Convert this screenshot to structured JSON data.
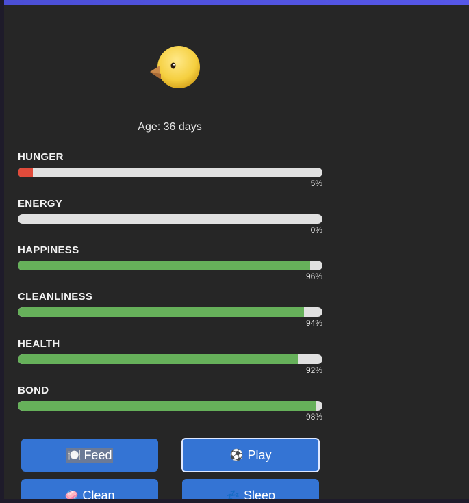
{
  "pet": {
    "age_text": "Age: 36 days",
    "icon": "baby-chick-icon"
  },
  "stats": [
    {
      "label": "HUNGER",
      "percent_text": "5%",
      "value": 5,
      "color": "#e14b3b"
    },
    {
      "label": "ENERGY",
      "percent_text": "0%",
      "value": 0,
      "color": "#66b05a"
    },
    {
      "label": "HAPPINESS",
      "percent_text": "96%",
      "value": 96,
      "color": "#66b05a"
    },
    {
      "label": "CLEANLINESS",
      "percent_text": "94%",
      "value": 94,
      "color": "#66b05a"
    },
    {
      "label": "HEALTH",
      "percent_text": "92%",
      "value": 92,
      "color": "#66b05a"
    },
    {
      "label": "BOND",
      "percent_text": "98%",
      "value": 98,
      "color": "#66b05a"
    }
  ],
  "actions": {
    "feed": {
      "label": "Feed",
      "icon": "🍽️"
    },
    "play": {
      "label": "Play",
      "icon": "⚽"
    },
    "clean": {
      "label": "Clean",
      "icon": "🧼"
    },
    "sleep": {
      "label": "Sleep",
      "icon": "💤"
    }
  },
  "colors": {
    "button": "#3474d4",
    "accent": "#4b4fd6",
    "background": "#262626"
  }
}
